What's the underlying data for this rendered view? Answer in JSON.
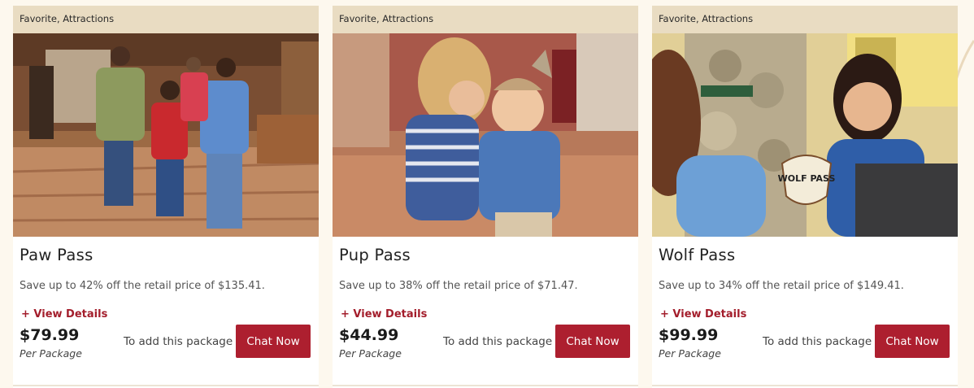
{
  "cards": [
    {
      "tags": "Favorite, Attractions",
      "title": "Paw Pass",
      "savings": "Save up to 42% off the retail price of $135.41.",
      "details_label": "+ View Details",
      "price": "$79.99",
      "per": "Per Package",
      "add_text": "To add this package",
      "chat_label": "Chat Now"
    },
    {
      "tags": "Favorite, Attractions",
      "title": "Pup Pass",
      "savings": "Save up to 38% off the retail price of $71.47.",
      "details_label": "+ View Details",
      "price": "$44.99",
      "per": "Per Package",
      "add_text": "To add this package",
      "chat_label": "Chat Now"
    },
    {
      "tags": "Favorite, Attractions",
      "title": "Wolf Pass",
      "savings": "Save up to 34% off the retail price of $149.41.",
      "details_label": "+ View Details",
      "price": "$99.99",
      "per": "Per Package",
      "add_text": "To add this package",
      "chat_label": "Chat Now",
      "photo_badge_text": "WOLF PASS"
    }
  ],
  "colors": {
    "accent": "#ad1f2f",
    "tag_bg": "#e9dcc2",
    "page_bg": "#fdf8ee"
  }
}
